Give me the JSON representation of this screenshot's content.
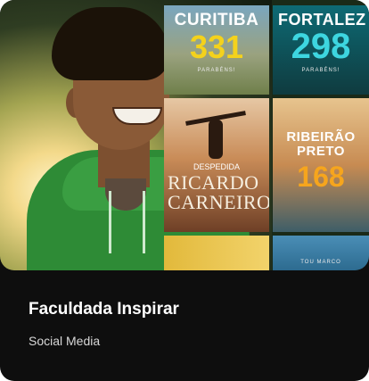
{
  "card": {
    "title": "Faculdada Inspirar",
    "subtitle": "Social Media"
  },
  "thumbnails": {
    "curitiba": {
      "title": "CURITIBA",
      "number": "331",
      "footer": "PARABÉNS!"
    },
    "fortaleza": {
      "title": "FORTALEZ",
      "number": "298",
      "footer": "PARABÉNS!"
    },
    "ricardo": {
      "small": "DESPEDIDA",
      "name": "RICARDO\nCARNEIRO"
    },
    "ribeirao": {
      "title": "RIBEIRÃO\nPRETO",
      "number": "168"
    },
    "bottom_right": {
      "footer": "TOU MARCO"
    }
  },
  "colors": {
    "card_bg": "#0e0e0e",
    "hoodie": "#2e8b36",
    "curitiba_number": "#f4d21c",
    "fortaleza_number": "#3dd6e0",
    "ribeirao_number": "#f6a51d"
  }
}
